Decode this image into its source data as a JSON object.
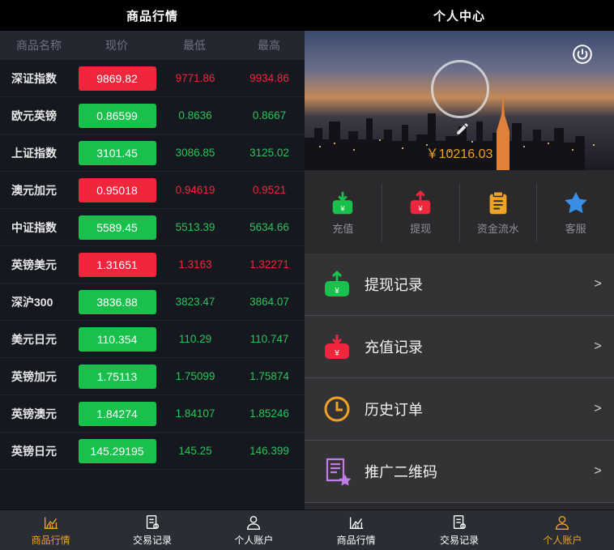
{
  "left": {
    "title": "商品行情",
    "columns": [
      "商品名称",
      "现价",
      "最低",
      "最高"
    ],
    "rows": [
      {
        "name": "深证指数",
        "price": "9869.82",
        "low": "9771.86",
        "high": "9934.86",
        "trend": "up"
      },
      {
        "name": "欧元英镑",
        "price": "0.86599",
        "low": "0.8636",
        "high": "0.8667",
        "trend": "down"
      },
      {
        "name": "上证指数",
        "price": "3101.45",
        "low": "3086.85",
        "high": "3125.02",
        "trend": "down"
      },
      {
        "name": "澳元加元",
        "price": "0.95018",
        "low": "0.94619",
        "high": "0.9521",
        "trend": "up"
      },
      {
        "name": "中证指数",
        "price": "5589.45",
        "low": "5513.39",
        "high": "5634.66",
        "trend": "down"
      },
      {
        "name": "英镑美元",
        "price": "1.31651",
        "low": "1.3163",
        "high": "1.32271",
        "trend": "up"
      },
      {
        "name": "深沪300",
        "price": "3836.88",
        "low": "3823.47",
        "high": "3864.07",
        "trend": "down"
      },
      {
        "name": "美元日元",
        "price": "110.354",
        "low": "110.29",
        "high": "110.747",
        "trend": "down"
      },
      {
        "name": "英镑加元",
        "price": "1.75113",
        "low": "1.75099",
        "high": "1.75874",
        "trend": "down"
      },
      {
        "name": "英镑澳元",
        "price": "1.84274",
        "low": "1.84107",
        "high": "1.85246",
        "trend": "down"
      },
      {
        "name": "英镑日元",
        "price": "145.29195",
        "low": "145.25",
        "high": "146.399",
        "trend": "down"
      }
    ],
    "tabs": [
      {
        "label": "商品行情",
        "icon": "chart-icon",
        "active": true
      },
      {
        "label": "交易记录",
        "icon": "record-icon",
        "active": false
      },
      {
        "label": "个人账户",
        "icon": "user-icon",
        "active": false
      }
    ]
  },
  "right": {
    "title": "个人中心",
    "balance": "￥10216.03",
    "quick": [
      {
        "label": "充值",
        "icon": "deposit-icon",
        "color": "#19c14c"
      },
      {
        "label": "提现",
        "icon": "withdraw-icon",
        "color": "#f0263c"
      },
      {
        "label": "资金流水",
        "icon": "ledger-icon",
        "color": "#f0a224"
      },
      {
        "label": "客服",
        "icon": "star-icon",
        "color": "#3a8ee6"
      }
    ],
    "menu": [
      {
        "label": "提现记录",
        "icon": "withdraw-record-icon",
        "chevron": ">"
      },
      {
        "label": "充值记录",
        "icon": "deposit-record-icon",
        "chevron": ">"
      },
      {
        "label": "历史订单",
        "icon": "clock-icon",
        "chevron": ">"
      },
      {
        "label": "推广二维码",
        "icon": "qrcode-doc-icon",
        "chevron": ">"
      }
    ],
    "tabs": [
      {
        "label": "商品行情",
        "icon": "chart-icon",
        "active": false
      },
      {
        "label": "交易记录",
        "icon": "record-icon",
        "active": false
      },
      {
        "label": "个人账户",
        "icon": "user-icon",
        "active": true
      }
    ]
  },
  "colors": {
    "up": "#f0263c",
    "down": "#19c14c",
    "accent": "#f0a224"
  }
}
